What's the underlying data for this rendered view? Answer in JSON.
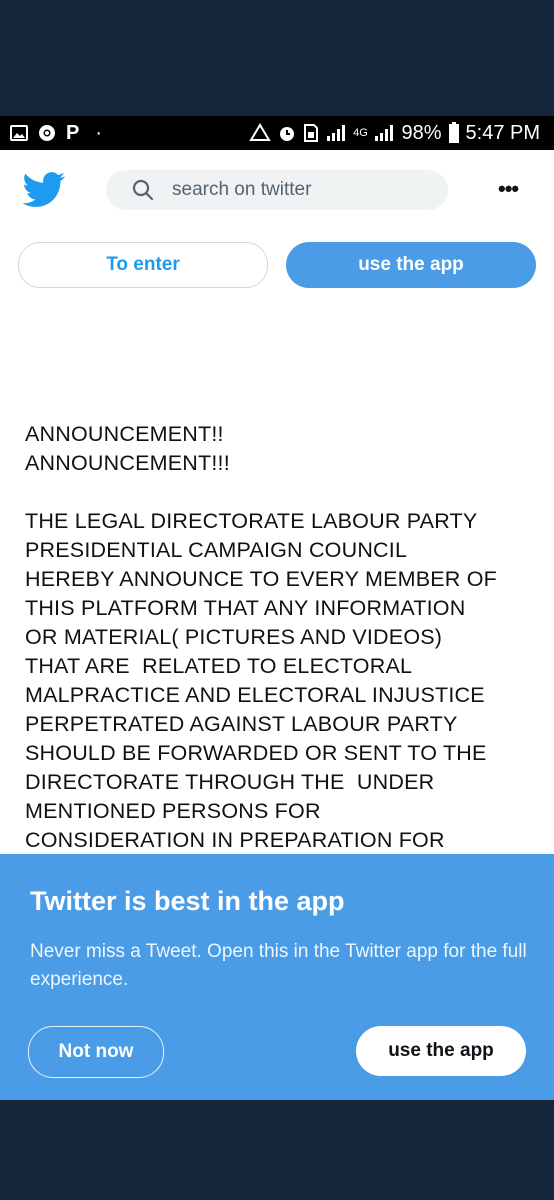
{
  "status_bar": {
    "left_icons": [
      "image-icon",
      "chrome-icon",
      "p-icon",
      "dot-icon"
    ],
    "p_letter": "P",
    "dot": "·",
    "network": "4G",
    "battery": "98%",
    "time": "5:47 PM"
  },
  "header": {
    "logo": "twitter-bird-icon",
    "search_placeholder": "search on twitter",
    "more": "•••"
  },
  "buttons": {
    "enter": "To enter",
    "use_app": "use the app"
  },
  "tweet": {
    "clipped_line": "ANNOUNCEMENT!",
    "lines": "ANNOUNCEMENT!!\nANNOUNCEMENT!!!\n\nTHE LEGAL DIRECTORATE LABOUR PARTY\nPRESIDENTIAL CAMPAIGN COUNCIL\nHEREBY ANNOUNCE TO EVERY MEMBER OF\nTHIS PLATFORM THAT ANY INFORMATION\nOR MATERIAL( PICTURES AND VIDEOS)\nTHAT ARE  RELATED TO ELECTORAL\nMALPRACTICE AND ELECTORAL INJUSTICE\nPERPETRATED AGAINST LABOUR PARTY\nSHOULD BE FORWARDED OR SENT TO THE\nDIRECTORATE THROUGH THE  UNDER\nMENTIONED PERSONS FOR\nCONSIDERATION IN PREPARATION FOR\nLEGAL REDRESS.\n\nTHANK YOU"
  },
  "banner": {
    "title": "Twitter is best in the app",
    "description": "Never miss a Tweet. Open this in the Twitter app for the full experience.",
    "not_now": "Not now",
    "use_app": "use the app"
  },
  "colors": {
    "accent": "#4a9ce6",
    "twitter_blue": "#1d9bf0",
    "frame": "#15253a"
  }
}
